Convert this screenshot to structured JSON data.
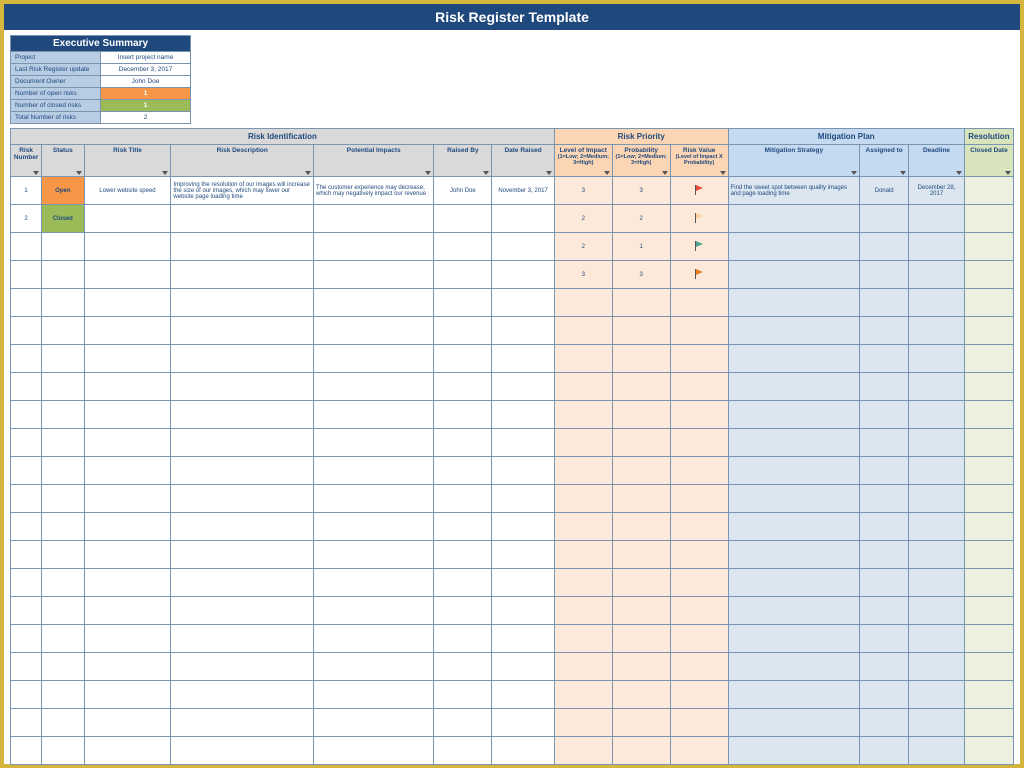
{
  "title": "Risk Register Template",
  "summary": {
    "heading": "Executive Summary",
    "rows": [
      {
        "label": "Project",
        "value": "Insert project name",
        "cls": ""
      },
      {
        "label": "Last Risk Register update",
        "value": "December 3, 2017",
        "cls": ""
      },
      {
        "label": "Document Owner",
        "value": "John Doe",
        "cls": ""
      },
      {
        "label": "Number of open risks",
        "value": "1",
        "cls": "open-val"
      },
      {
        "label": "Number of closed risks",
        "value": "1",
        "cls": "closed-val"
      },
      {
        "label": "Total Number of risks",
        "value": "2",
        "cls": ""
      }
    ]
  },
  "groups": {
    "identification": "Risk Identification",
    "priority": "Risk Priority",
    "mitigation": "Mitigation Plan",
    "resolution": "Resolution"
  },
  "headers": {
    "number": "Risk Number",
    "status": "Status",
    "title": "Risk Title",
    "description": "Risk Description",
    "impacts": "Potential Impacts",
    "raised_by": "Raised By",
    "date_raised": "Date Raised",
    "impact": "Level of Impact",
    "impact_sub": "(1=Low; 2=Medium; 3=High)",
    "probability": "Probability",
    "probability_sub": "(1=Low; 2=Medium; 3=High)",
    "risk_value": "Risk Value",
    "risk_value_sub": "(Level of Impact X Probability)",
    "strategy": "Mitigation Strategy",
    "assigned": "Assigned to",
    "deadline": "Deadline",
    "closed": "Closed Date"
  },
  "rows": [
    {
      "number": "1",
      "status": "Open",
      "status_cls": "status-open",
      "title": "Lower website speed",
      "description": "Improving the resolution of our images will increase the size of our images, which may lower our website page loading time",
      "impacts": "The customer experience may decrease, which may negatively impact our revenue",
      "raised_by": "John Doe",
      "date_raised": "November 3, 2017",
      "impact": "3",
      "probability": "3",
      "flag": "red",
      "strategy": "Find the sweet spot between quality images and page loading time",
      "assigned": "Donald",
      "deadline": "December 28, 2017",
      "closed": ""
    },
    {
      "number": "2",
      "status": "Closed",
      "status_cls": "status-closed",
      "title": "",
      "description": "",
      "impacts": "",
      "raised_by": "",
      "date_raised": "",
      "impact": "2",
      "probability": "2",
      "flag": "cream",
      "strategy": "",
      "assigned": "",
      "deadline": "",
      "closed": ""
    },
    {
      "number": "",
      "status": "",
      "status_cls": "",
      "title": "",
      "description": "",
      "impacts": "",
      "raised_by": "",
      "date_raised": "",
      "impact": "2",
      "probability": "1",
      "flag": "teal",
      "strategy": "",
      "assigned": "",
      "deadline": "",
      "closed": ""
    },
    {
      "number": "",
      "status": "",
      "status_cls": "",
      "title": "",
      "description": "",
      "impacts": "",
      "raised_by": "",
      "date_raised": "",
      "impact": "3",
      "probability": "3",
      "flag": "orange",
      "strategy": "",
      "assigned": "",
      "deadline": "",
      "closed": ""
    }
  ],
  "blank_rows": 17
}
